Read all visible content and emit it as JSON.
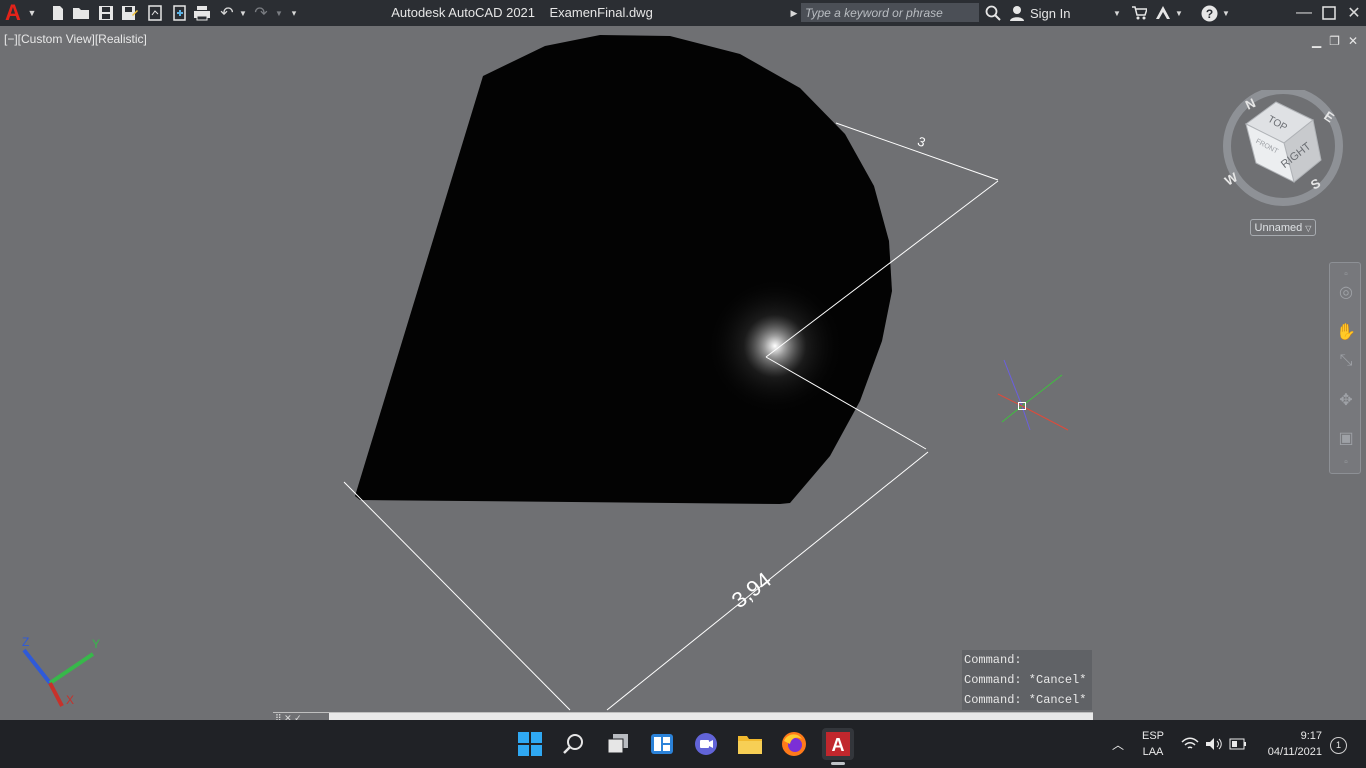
{
  "window": {
    "title": "Autodesk AutoCAD 2021    ExamenFinal.dwg",
    "logo_letter": "A",
    "search_placeholder": "Type a keyword or phrase",
    "sign_in": "Sign In",
    "qat_icons": [
      "new-icon",
      "open-icon",
      "save-icon",
      "save-as-icon",
      "plot-icon",
      "publish-icon",
      "print-icon",
      "undo-icon",
      "redo-icon",
      "customize-icon"
    ]
  },
  "viewport": {
    "label": "[−][Custom View][Realistic]",
    "controls": [
      "minimize-icon",
      "restore-icon",
      "close-icon"
    ]
  },
  "dimensions": {
    "long": "3,94",
    "short": "3"
  },
  "viewcube": {
    "top": "TOP",
    "right": "RIGHT",
    "front": "FRONT",
    "north": "N",
    "east": "E",
    "south": "S",
    "west": "W",
    "named_view": "Unnamed"
  },
  "ucs": {
    "x": "X",
    "y": "Y",
    "z": "Z"
  },
  "command_history": [
    "Command:",
    "Command: *Cancel*",
    "Command: *Cancel*"
  ],
  "taskbar": {
    "apps": [
      "windows-start-icon",
      "search-icon",
      "task-view-icon",
      "widgets-icon",
      "teams-chat-icon",
      "file-explorer-icon",
      "firefox-icon",
      "autocad-icon"
    ],
    "lang_line1": "ESP",
    "lang_line2": "LAA",
    "time": "9:17",
    "date": "04/11/2021",
    "notifications": "1"
  },
  "colors": {
    "titlebar": "#2b2e33",
    "viewport": "#6f7073",
    "taskbar": "#202226",
    "autocad_red": "#e2231a"
  }
}
